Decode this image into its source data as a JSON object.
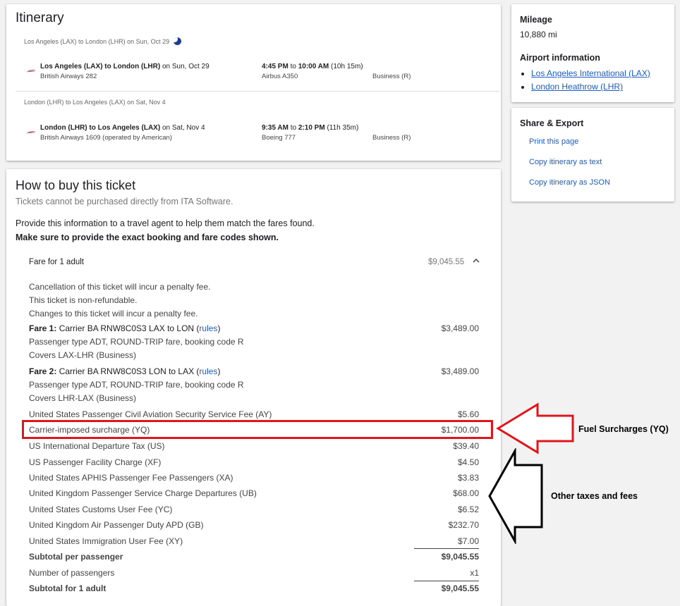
{
  "itinerary": {
    "title": "Itinerary",
    "segments": [
      {
        "header": "Los Angeles (LAX) to London (LHR) on Sun, Oct 29",
        "route_bold": "Los Angeles (LAX) to London (LHR)",
        "route_date": " on Sun, Oct 29",
        "carrier": "British Airways 282",
        "time_bold_dep": "4:45 PM",
        "time_to": " to ",
        "time_bold_arr": "10:00 AM",
        "duration": " (10h 15m)",
        "aircraft": "Airbus A350",
        "cabin": "Business (R)"
      },
      {
        "header": "London (LHR) to Los Angeles (LAX) on Sat, Nov 4",
        "route_bold": "London (LHR) to Los Angeles (LAX)",
        "route_date": " on Sat, Nov 4",
        "carrier": "British Airways 1609 (operated by American)",
        "time_bold_dep": "9:35 AM",
        "time_to": " to ",
        "time_bold_arr": "2:10 PM",
        "duration": " (11h 35m)",
        "aircraft": "Boeing 777",
        "cabin": "Business (R)"
      }
    ]
  },
  "sidebar": {
    "mileage_title": "Mileage",
    "mileage_value": "10,880 mi",
    "airport_title": "Airport information",
    "airports": [
      "Los Angeles International (LAX)",
      "London Heathrow (LHR)"
    ],
    "share_title": "Share & Export",
    "links": [
      "Print this page",
      "Copy itinerary as text",
      "Copy itinerary as JSON"
    ]
  },
  "buy": {
    "title": "How to buy this ticket",
    "subtitle": "Tickets cannot be purchased directly from ITA Software.",
    "instruction": "Provide this information to a travel agent to help them match the fares found.",
    "instruction_bold": "Make sure to provide the exact booking and fare codes shown.",
    "fare_header_label": "Fare for 1 adult",
    "fare_header_amount": "$9,045.55",
    "penalties": [
      "Cancellation of this ticket will incur a penalty fee.",
      "This ticket is non-refundable.",
      "Changes to this ticket will incur a penalty fee."
    ],
    "fares": [
      {
        "label_bold": "Fare 1:",
        "label": " Carrier BA RNW8C0S3 LAX to LON (",
        "rules": "rules",
        "close": ")",
        "amount": "$3,489.00",
        "line2": "Passenger type ADT, ROUND-TRIP fare, booking code R",
        "line3": "Covers LAX-LHR (Business)"
      },
      {
        "label_bold": "Fare 2:",
        "label": " Carrier BA RNW8C0S3 LON to LAX (",
        "rules": "rules",
        "close": ")",
        "amount": "$3,489.00",
        "line2": "Passenger type ADT, ROUND-TRIP fare, booking code R",
        "line3": "Covers LHR-LAX (Business)"
      }
    ],
    "taxes": [
      {
        "label": "United States Passenger Civil Aviation Security Service Fee (AY)",
        "amount": "$5.60"
      },
      {
        "label": "Carrier-imposed surcharge (YQ)",
        "amount": "$1,700.00"
      },
      {
        "label": "US International Departure Tax (US)",
        "amount": "$39.40"
      },
      {
        "label": "US Passenger Facility Charge (XF)",
        "amount": "$4.50"
      },
      {
        "label": "United States APHIS Passenger Fee Passengers (XA)",
        "amount": "$3.83"
      },
      {
        "label": "United Kingdom Passenger Service Charge Departures (UB)",
        "amount": "$68.00"
      },
      {
        "label": "United States Customs User Fee (YC)",
        "amount": "$6.52"
      },
      {
        "label": "United Kingdom Air Passenger Duty APD (GB)",
        "amount": "$232.70"
      },
      {
        "label": "United States Immigration User Fee (XY)",
        "amount": "$7.00"
      }
    ],
    "subtotal_per_passenger_label": "Subtotal per passenger",
    "subtotal_per_passenger_amount": "$9,045.55",
    "num_passengers_label": "Number of passengers",
    "num_passengers_value": "x1",
    "subtotal_adult_label": "Subtotal for 1 adult",
    "subtotal_adult_amount": "$9,045.55"
  },
  "annotations": {
    "fuel": "Fuel Surcharges (YQ)",
    "other": "Other taxes and fees",
    "highlight_color": "#e0161d"
  }
}
